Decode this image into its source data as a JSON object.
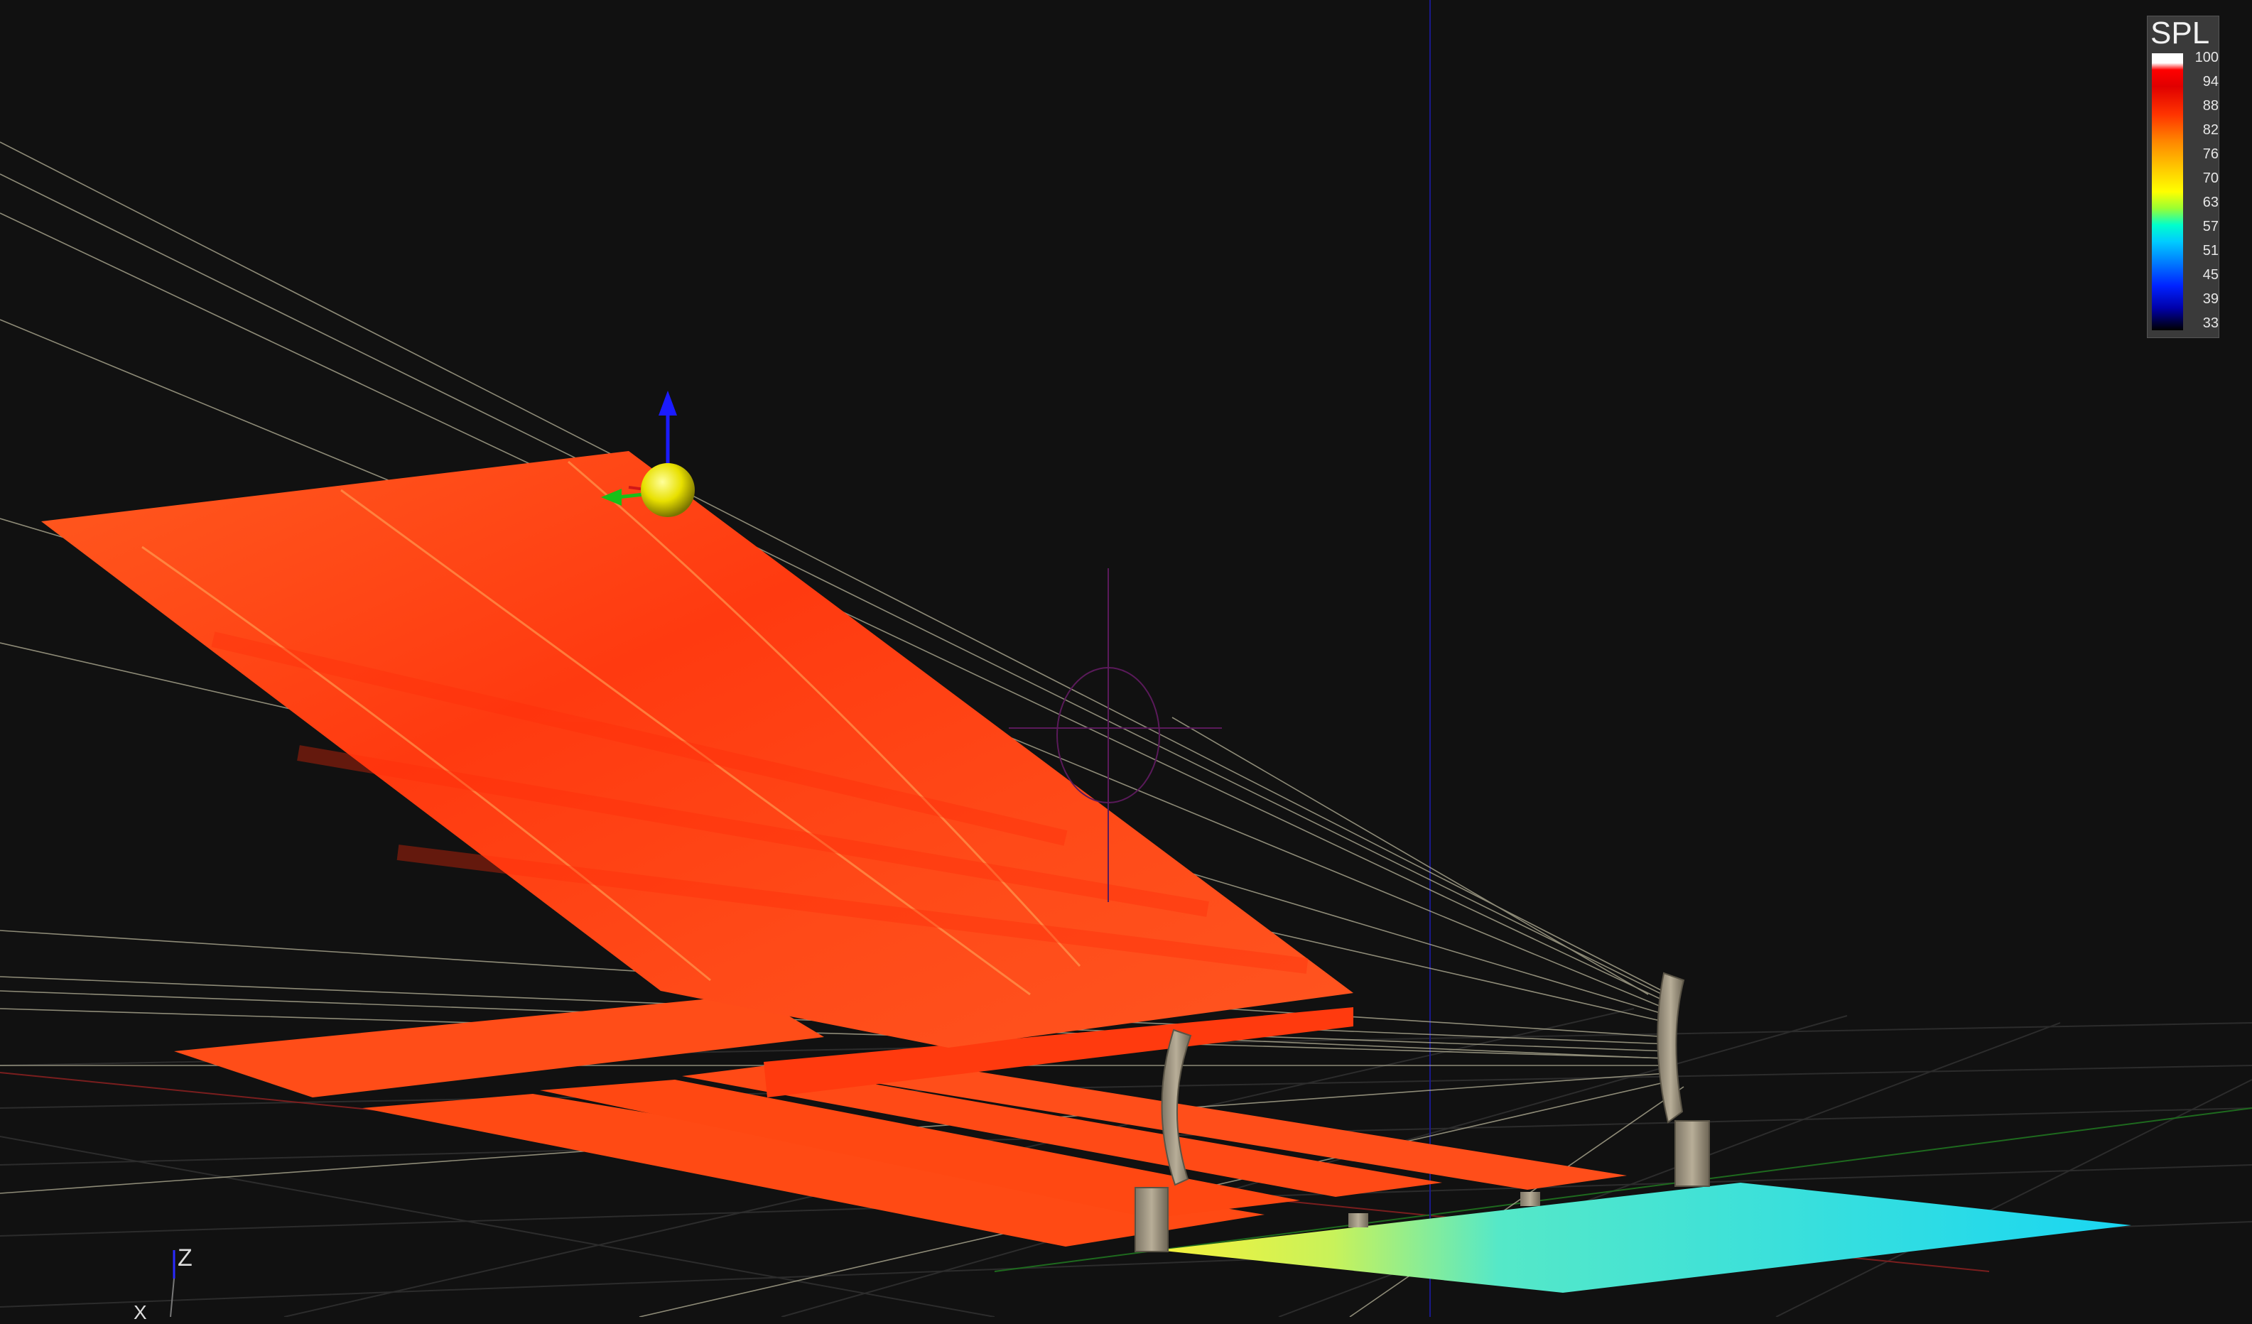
{
  "legend": {
    "title": "SPL",
    "ticks": [
      "100",
      "94",
      "88",
      "82",
      "76",
      "70",
      "63",
      "57",
      "51",
      "45",
      "39",
      "33"
    ]
  },
  "axes": {
    "z_label": "Z",
    "x_label": "X"
  },
  "colors": {
    "background": "#111111",
    "surface_main": "#ff4a14",
    "floor_cyan": "#22d8f0",
    "floor_yellow": "#f5f03a",
    "source_sphere": "#f2f000",
    "speaker_array": "#a89e8a",
    "gizmo_z": "#1b1bff",
    "gizmo_x": "#18c018"
  }
}
